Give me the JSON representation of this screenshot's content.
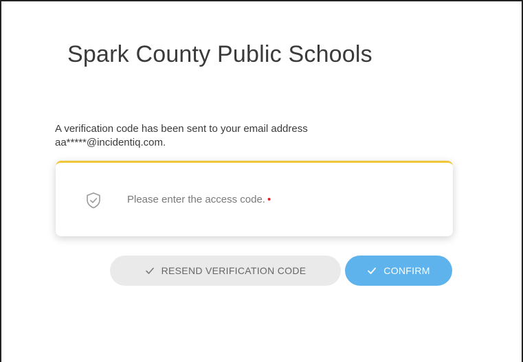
{
  "title": "Spark County Public Schools",
  "message": {
    "line1": "A verification code has been sent to your email address",
    "line2": "aa*****@incidentiq.com."
  },
  "code_field": {
    "placeholder": "Please enter the access code.",
    "required_mark": "•",
    "value": "",
    "icon": "shield-check-icon"
  },
  "buttons": {
    "resend_label": "RESEND VERIFICATION CODE",
    "confirm_label": "CONFIRM"
  },
  "colors": {
    "card_accent": "#f2c63a",
    "confirm_bg": "#5fb3ec",
    "resend_bg": "#eaeaea",
    "required": "#d8232a"
  }
}
